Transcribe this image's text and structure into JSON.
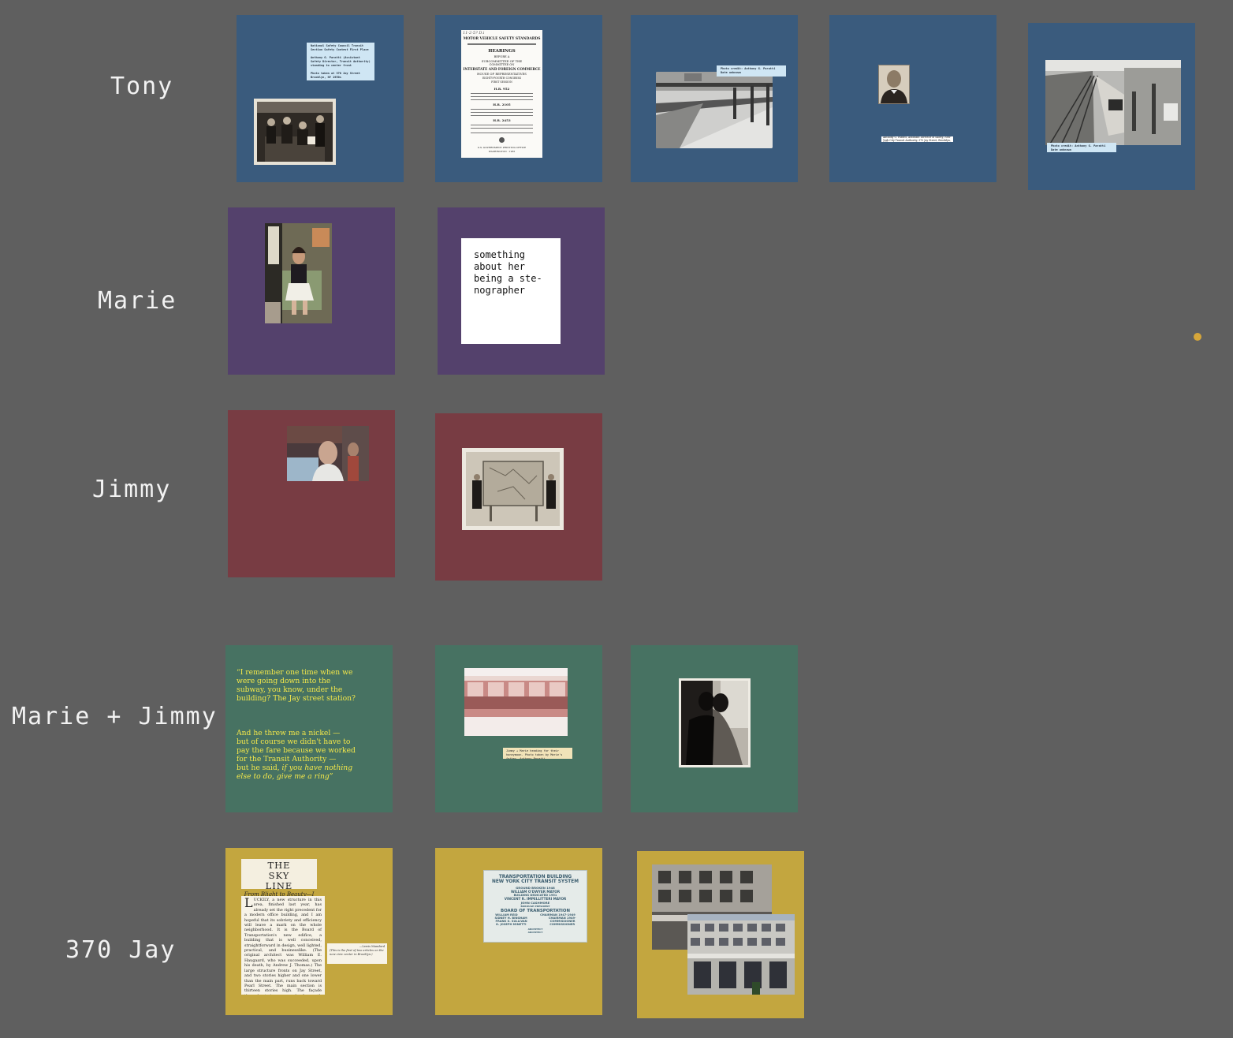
{
  "colors": {
    "background": "#5f5f5f",
    "tony": "#3a5b7d",
    "marie": "#54416c",
    "jimmy": "#783c43",
    "marie_jimmy": "#477262",
    "jay": "#c3a63f",
    "quote_text": "#f4e84a",
    "dot": "#d6a63a"
  },
  "rows": {
    "tony": "Tony",
    "marie": "Marie",
    "jimmy": "Jimmy",
    "marie_jimmy": "Marie + Jimmy",
    "jay": "370 Jay"
  },
  "tony_cards": {
    "card1_tag": "National Safety Council Transit Section Safety Contest First Place\n\nAnthony G. Paratti (Assistant Safety Director, Transit Authority) standing to center front\n\nPhoto taken at 370 Jay Street Brooklyn, NY 1950s",
    "card2_doc": {
      "handwritten": "11-2-5? D.i",
      "heading": "MOTOR VEHICLE SAFETY STANDARDS",
      "title": "HEARINGS",
      "sub1": "BEFORE A",
      "sub2": "SUBCOMMITTEE OF THE",
      "sub3": "COMMITTEE ON",
      "sub4": "INTERSTATE AND FOREIGN COMMERCE",
      "sub5": "HOUSE OF REPRESENTATIVES",
      "sub6": "EIGHTY-FOURTH CONGRESS",
      "sub7": "FIRST SESSION",
      "bill1": "H.R. 952",
      "bill2": "H.R. 2105",
      "bill3": "H.R. 2453",
      "footer": "U.S. GOVERNMENT PRINTING OFFICE",
      "footer2": "WASHINGTON : 1955"
    },
    "card3_tag": "Photo credit: Anthony G. Paratti Date unknown",
    "card4_tag": "Anthony G. Paratti, Assistant Director of Safety, New York City Transit Authority, 370 Jay Street, Brooklyn, N.Y.",
    "card5_tag": "Photo credit: Anthony G. Paratti Date unknown"
  },
  "marie_cards": {
    "note": "something\nabout her\nbeing a ste-\nnographer"
  },
  "marie_jimmy_cards": {
    "quote_part1": "“I remember one time when we\nwere going down into the\nsubway, you know, under the\nbuilding? The Jay street station?",
    "quote_part2": "And he threw me a nickel —\nbut of course we didn't have to\npay the fare because we worked\nfor the Transit Authority —\nbut he said, ",
    "quote_italic": "if you have nothing\nelse to do, give me a ring”",
    "card2_tag": "Jimmy + Marie heading for their honeymoon. Photo taken by Marie's father, Anthony Paratti"
  },
  "jay_cards": {
    "sky_title": "THE SKY LINE",
    "sky_sub": "From Blight to Beauty—I",
    "article_dropcap": "L",
    "article": "UCKILY, a new structure in this area, finished last year, has already set the right precedent for a modern office building, and I am hopeful that its sobriety and efficiency will leave a mark on the whole neighborhood. It is the Board of Transportation's new edifice, a building that is well conceived, straightforward in design, well lighted, practical, and businesslike. (The original architect was William E. Haugaard, who was succeeded, upon his death, by Andrew J. Thomas.) The large structure fronts on Jay Street, and two stories higher and one lower than the main part, runs back toward Pearl Street. The main section is thirteen stories high. The façade throughout is composed of smooth limestone, and there is a neat blue-lettered entrance to punctuate the top. The windows are large panels of",
    "clip_credit": "—Lewis Mumford",
    "clip_text": "(This is the first of two articles on the new civic center in Brooklyn.)",
    "plaque": {
      "line1": "TRANSPORTATION BUILDING",
      "line2": "NEW YORK CITY TRANSIT SYSTEM",
      "line3": "GROUND BROKEN 1948",
      "line4": "WILLIAM O'DWYER MAYOR",
      "line5": "BUILDING DEDICATED 1951",
      "line6": "VINCENT R. IMPELLITTERI MAYOR",
      "line7": "JOHN CASHMORE",
      "line8": "BOROUGH PRESIDENT",
      "line9": "BOARD OF TRANSPORTATION",
      "line10a": "WILLIAM REID",
      "line10b": "CHAIRMAN 1947-1949",
      "line11a": "SIDNEY H. BINGHAM",
      "line11b": "CHAIRMAN 1949-",
      "line12a": "FRANK X. SULLIVAN",
      "line12b": "COMMISSIONER",
      "line13a": "G. JOSEPH MINETTI",
      "line13b": "COMMISSIONER",
      "line14": "ARCHITECT",
      "line15": "ARCHITECT"
    }
  }
}
